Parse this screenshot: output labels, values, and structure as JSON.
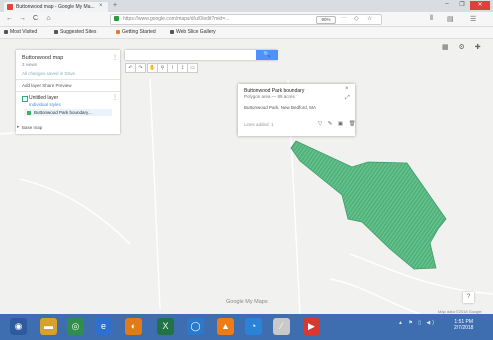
{
  "browser": {
    "tab_title": "Buttonwood map - Google My Ma...",
    "tab_close": "×",
    "new_tab": "+",
    "url": "https://www.google.com/maps/d/u/0/edit?mid=...",
    "zoom": "90%",
    "url_more": "···",
    "window_controls": {
      "minimize": "–",
      "maximize": "❐",
      "close": "✕"
    },
    "nav": {
      "back": "←",
      "forward": "→",
      "reload": "C",
      "home": "⌂"
    },
    "toolbar_icons": [
      "⫴",
      "▤",
      "☰"
    ]
  },
  "bookmarks": [
    {
      "label": "Most Visited"
    },
    {
      "label": "Suggested Sites"
    },
    {
      "label": "Getting Started"
    },
    {
      "label": "Web Slice Gallery"
    }
  ],
  "left_panel": {
    "title": "Buttonwood map",
    "views": "3 views",
    "share_row": "All changes saved in Drive",
    "menu": "⋮",
    "actions": "Add layer   Share   Preview",
    "layer": {
      "name": "Untitled layer",
      "style": "Individual styles",
      "feature": "Buttonwood Park boundary...",
      "menu": "⋮"
    },
    "basemap": "Base map",
    "basemap_arrow": "▸"
  },
  "search": {
    "button": "🔍"
  },
  "tools": [
    "↶",
    "↷",
    "✋",
    "⚲",
    "⌇",
    "⟟",
    "▭"
  ],
  "popup": {
    "title": "Buttonwood Park boundary",
    "subtitle": "Polygon area — 89 acres",
    "description": "Buttonwood Park, New Bedford, MA",
    "footer": "Lines added: 1",
    "close": "×",
    "expand": "⤢",
    "icons": "▽ ✎ ▣ 🗑"
  },
  "map": {
    "polygon_color": "#4fb37a",
    "google_label": "Google My Maps",
    "help": "?",
    "topright_icons": "▦ ⚙ ✚",
    "scale": "Map data ©2018 Google"
  },
  "taskbar": {
    "color": "#3f6eb0",
    "apps": [
      {
        "icon": "start-orb-icon",
        "glyph": "◉",
        "color": "#2e5aa0"
      },
      {
        "icon": "explorer-icon",
        "glyph": "▬",
        "color": "#d7a22c"
      },
      {
        "icon": "chrome-icon",
        "glyph": "◎",
        "color": "#2f8f4a"
      },
      {
        "icon": "ie-icon",
        "glyph": "e",
        "color": "#2f6fcf"
      },
      {
        "icon": "firefox-icon",
        "glyph": "◐",
        "color": "#e2791a"
      },
      {
        "icon": "excel-icon",
        "glyph": "X",
        "color": "#217346"
      },
      {
        "icon": "globe-icon",
        "glyph": "◯",
        "color": "#2a7ac9"
      },
      {
        "icon": "vlc-icon",
        "glyph": "▲",
        "color": "#ee7b15"
      },
      {
        "icon": "browser2-icon",
        "glyph": "◔",
        "color": "#2b82d9"
      },
      {
        "icon": "tool-icon",
        "glyph": "⁄",
        "color": "#c9c9c9"
      },
      {
        "icon": "media-icon",
        "glyph": "▶",
        "color": "#d33b2f"
      }
    ],
    "tray": "▲ ⚑ ▯ ◀)",
    "time": "1:51 PM",
    "date": "2/7/2018"
  }
}
